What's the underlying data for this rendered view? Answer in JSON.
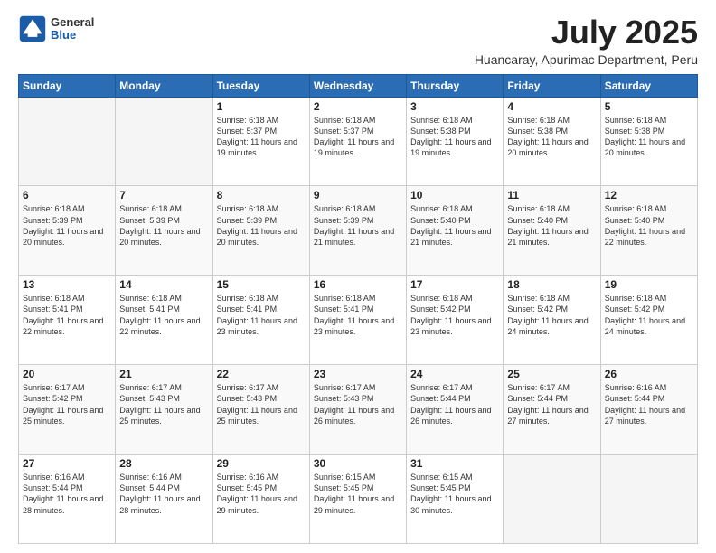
{
  "header": {
    "logo_general": "General",
    "logo_blue": "Blue",
    "month_title": "July 2025",
    "subtitle": "Huancaray, Apurimac Department, Peru"
  },
  "weekdays": [
    "Sunday",
    "Monday",
    "Tuesday",
    "Wednesday",
    "Thursday",
    "Friday",
    "Saturday"
  ],
  "weeks": [
    [
      {
        "day": "",
        "info": ""
      },
      {
        "day": "",
        "info": ""
      },
      {
        "day": "1",
        "info": "Sunrise: 6:18 AM\nSunset: 5:37 PM\nDaylight: 11 hours and 19 minutes."
      },
      {
        "day": "2",
        "info": "Sunrise: 6:18 AM\nSunset: 5:37 PM\nDaylight: 11 hours and 19 minutes."
      },
      {
        "day": "3",
        "info": "Sunrise: 6:18 AM\nSunset: 5:38 PM\nDaylight: 11 hours and 19 minutes."
      },
      {
        "day": "4",
        "info": "Sunrise: 6:18 AM\nSunset: 5:38 PM\nDaylight: 11 hours and 20 minutes."
      },
      {
        "day": "5",
        "info": "Sunrise: 6:18 AM\nSunset: 5:38 PM\nDaylight: 11 hours and 20 minutes."
      }
    ],
    [
      {
        "day": "6",
        "info": "Sunrise: 6:18 AM\nSunset: 5:39 PM\nDaylight: 11 hours and 20 minutes."
      },
      {
        "day": "7",
        "info": "Sunrise: 6:18 AM\nSunset: 5:39 PM\nDaylight: 11 hours and 20 minutes."
      },
      {
        "day": "8",
        "info": "Sunrise: 6:18 AM\nSunset: 5:39 PM\nDaylight: 11 hours and 20 minutes."
      },
      {
        "day": "9",
        "info": "Sunrise: 6:18 AM\nSunset: 5:39 PM\nDaylight: 11 hours and 21 minutes."
      },
      {
        "day": "10",
        "info": "Sunrise: 6:18 AM\nSunset: 5:40 PM\nDaylight: 11 hours and 21 minutes."
      },
      {
        "day": "11",
        "info": "Sunrise: 6:18 AM\nSunset: 5:40 PM\nDaylight: 11 hours and 21 minutes."
      },
      {
        "day": "12",
        "info": "Sunrise: 6:18 AM\nSunset: 5:40 PM\nDaylight: 11 hours and 22 minutes."
      }
    ],
    [
      {
        "day": "13",
        "info": "Sunrise: 6:18 AM\nSunset: 5:41 PM\nDaylight: 11 hours and 22 minutes."
      },
      {
        "day": "14",
        "info": "Sunrise: 6:18 AM\nSunset: 5:41 PM\nDaylight: 11 hours and 22 minutes."
      },
      {
        "day": "15",
        "info": "Sunrise: 6:18 AM\nSunset: 5:41 PM\nDaylight: 11 hours and 23 minutes."
      },
      {
        "day": "16",
        "info": "Sunrise: 6:18 AM\nSunset: 5:41 PM\nDaylight: 11 hours and 23 minutes."
      },
      {
        "day": "17",
        "info": "Sunrise: 6:18 AM\nSunset: 5:42 PM\nDaylight: 11 hours and 23 minutes."
      },
      {
        "day": "18",
        "info": "Sunrise: 6:18 AM\nSunset: 5:42 PM\nDaylight: 11 hours and 24 minutes."
      },
      {
        "day": "19",
        "info": "Sunrise: 6:18 AM\nSunset: 5:42 PM\nDaylight: 11 hours and 24 minutes."
      }
    ],
    [
      {
        "day": "20",
        "info": "Sunrise: 6:17 AM\nSunset: 5:42 PM\nDaylight: 11 hours and 25 minutes."
      },
      {
        "day": "21",
        "info": "Sunrise: 6:17 AM\nSunset: 5:43 PM\nDaylight: 11 hours and 25 minutes."
      },
      {
        "day": "22",
        "info": "Sunrise: 6:17 AM\nSunset: 5:43 PM\nDaylight: 11 hours and 25 minutes."
      },
      {
        "day": "23",
        "info": "Sunrise: 6:17 AM\nSunset: 5:43 PM\nDaylight: 11 hours and 26 minutes."
      },
      {
        "day": "24",
        "info": "Sunrise: 6:17 AM\nSunset: 5:44 PM\nDaylight: 11 hours and 26 minutes."
      },
      {
        "day": "25",
        "info": "Sunrise: 6:17 AM\nSunset: 5:44 PM\nDaylight: 11 hours and 27 minutes."
      },
      {
        "day": "26",
        "info": "Sunrise: 6:16 AM\nSunset: 5:44 PM\nDaylight: 11 hours and 27 minutes."
      }
    ],
    [
      {
        "day": "27",
        "info": "Sunrise: 6:16 AM\nSunset: 5:44 PM\nDaylight: 11 hours and 28 minutes."
      },
      {
        "day": "28",
        "info": "Sunrise: 6:16 AM\nSunset: 5:44 PM\nDaylight: 11 hours and 28 minutes."
      },
      {
        "day": "29",
        "info": "Sunrise: 6:16 AM\nSunset: 5:45 PM\nDaylight: 11 hours and 29 minutes."
      },
      {
        "day": "30",
        "info": "Sunrise: 6:15 AM\nSunset: 5:45 PM\nDaylight: 11 hours and 29 minutes."
      },
      {
        "day": "31",
        "info": "Sunrise: 6:15 AM\nSunset: 5:45 PM\nDaylight: 11 hours and 30 minutes."
      },
      {
        "day": "",
        "info": ""
      },
      {
        "day": "",
        "info": ""
      }
    ]
  ]
}
